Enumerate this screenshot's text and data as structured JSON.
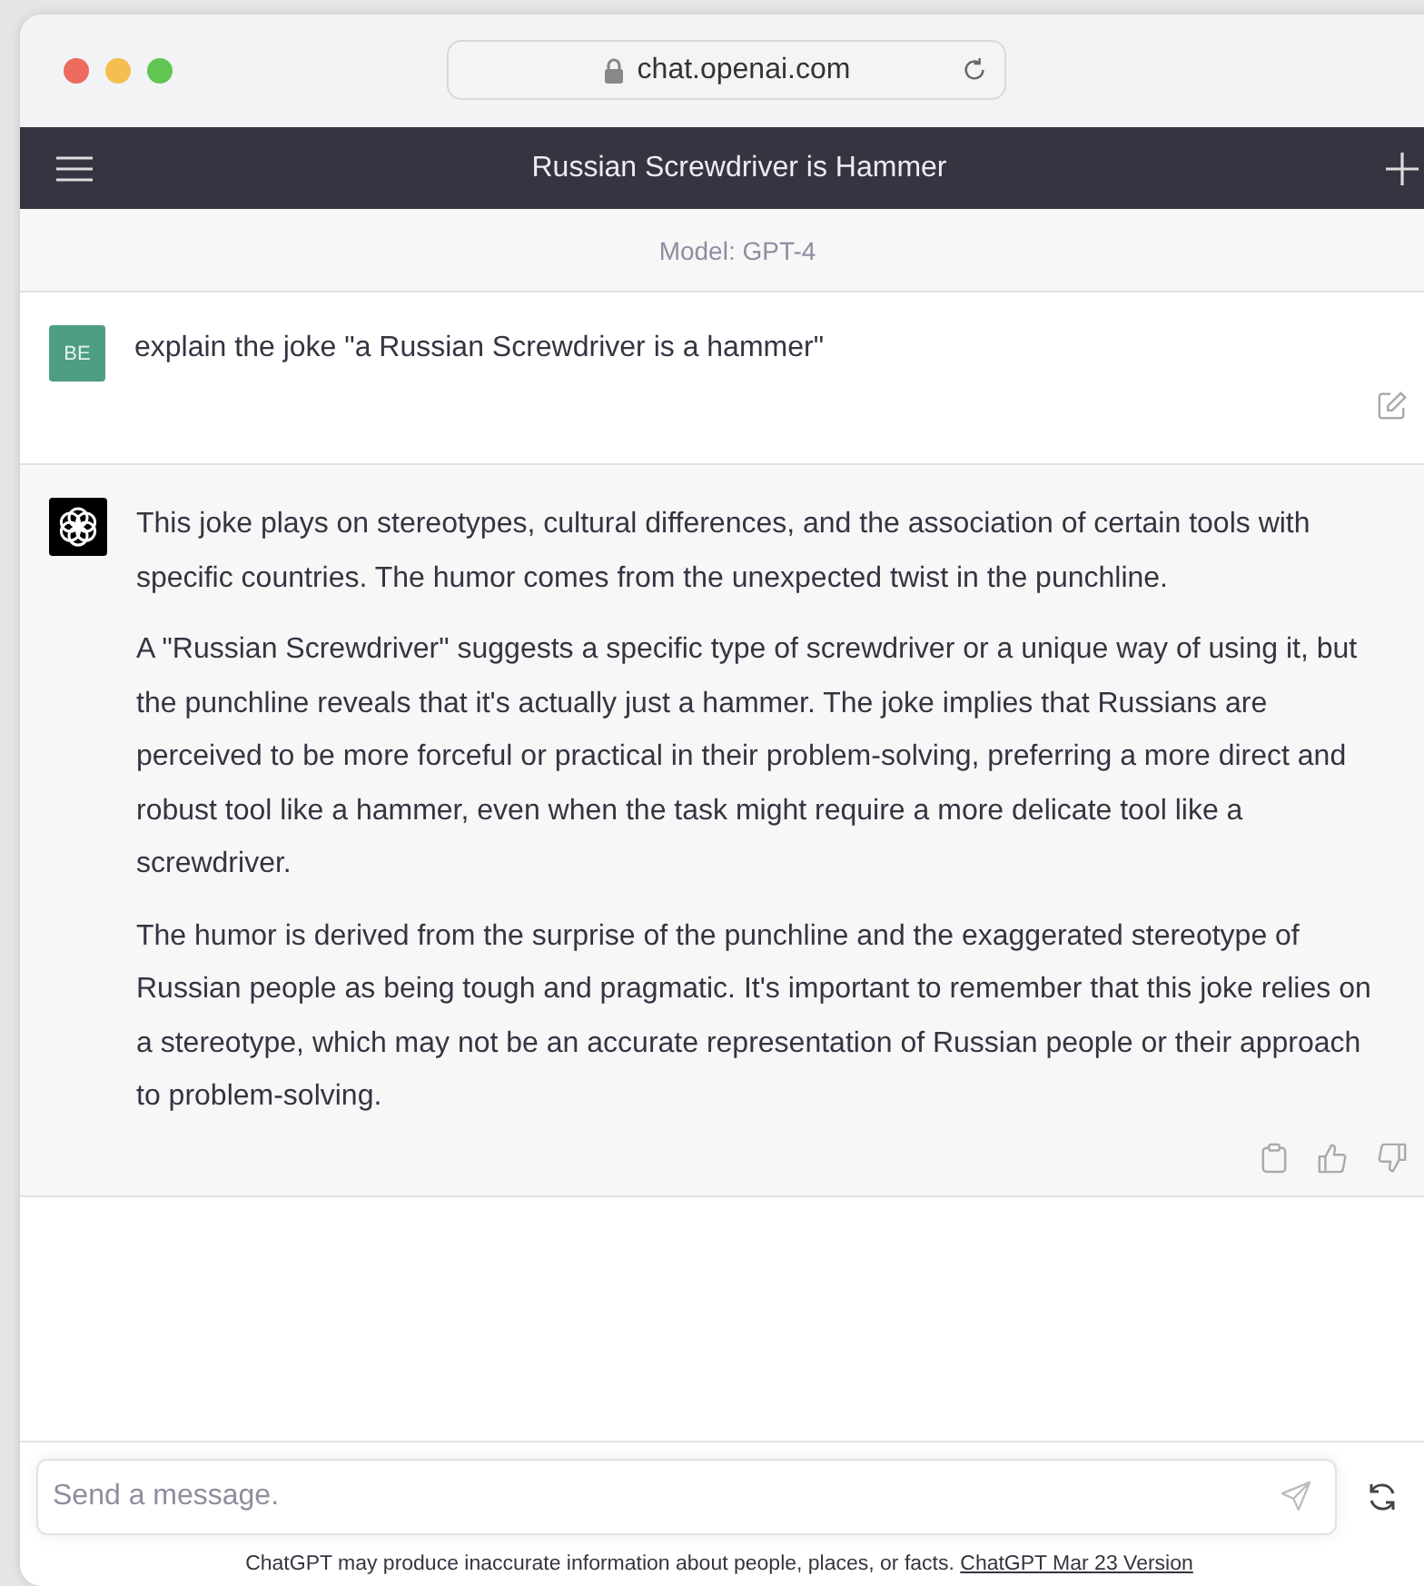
{
  "browser": {
    "address": "chat.openai.com"
  },
  "header": {
    "title": "Russian Screwdriver is Hammer"
  },
  "model_bar": {
    "label": "Model: GPT-4"
  },
  "messages": [
    {
      "kind": "user",
      "avatar": "BE",
      "paragraphs": [
        "explain the joke \"a Russian Screwdriver is a hammer\""
      ]
    },
    {
      "kind": "assistant",
      "paragraphs": [
        "This joke plays on stereotypes, cultural differences, and the association of certain tools with specific countries. The humor comes from the unexpected twist in the punchline.",
        "A \"Russian Screwdriver\" suggests a specific type of screwdriver or a unique way of using it, but the punchline reveals that it's actually just a hammer. The joke implies that Russians are perceived to be more forceful or practical in their problem-solving, preferring a more direct and robust tool like a hammer, even when the task might require a more delicate tool like a screwdriver.",
        "The humor is derived from the surprise of the punchline and the exaggerated stereotype of Russian people as being tough and pragmatic. It's important to remember that this joke relies on a stereotype, which may not be an accurate representation of Russian people or their approach to problem-solving."
      ]
    }
  ],
  "composer": {
    "placeholder": "Send a message."
  },
  "footer": {
    "text": "ChatGPT may produce inaccurate information about people, places, or facts.",
    "link": "ChatGPT Mar 23 Version"
  }
}
